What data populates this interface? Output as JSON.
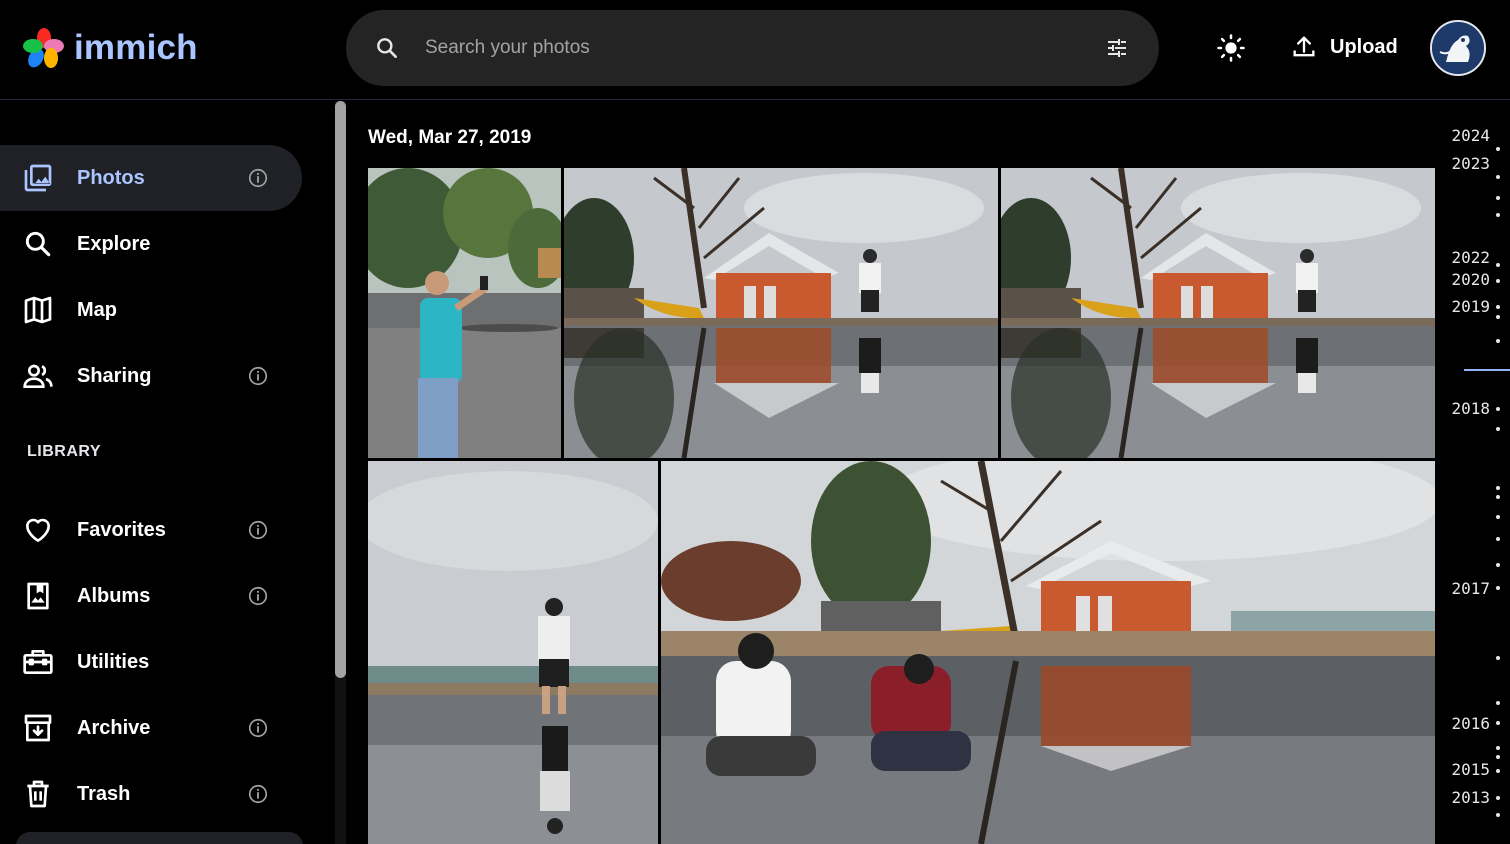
{
  "app": {
    "name": "immich"
  },
  "header": {
    "search_placeholder": "Search your photos",
    "upload_label": "Upload",
    "theme_toggle_icon": "sun-icon",
    "filter_icon": "sliders-icon"
  },
  "sidebar": {
    "items_top": [
      {
        "label": "Photos",
        "icon": "photos-icon",
        "active": true,
        "info": true
      },
      {
        "label": "Explore",
        "icon": "magnify-icon",
        "active": false,
        "info": false
      },
      {
        "label": "Map",
        "icon": "map-icon",
        "active": false,
        "info": false
      },
      {
        "label": "Sharing",
        "icon": "people-icon",
        "active": false,
        "info": true
      }
    ],
    "library_title": "LIBRARY",
    "items_library": [
      {
        "label": "Favorites",
        "icon": "heart-icon",
        "info": true
      },
      {
        "label": "Albums",
        "icon": "album-icon",
        "info": true
      },
      {
        "label": "Utilities",
        "icon": "toolbox-icon",
        "info": false
      },
      {
        "label": "Archive",
        "icon": "archive-icon",
        "info": true
      },
      {
        "label": "Trash",
        "icon": "trash-icon",
        "info": true
      }
    ]
  },
  "main": {
    "date_group_title": "Wed, Mar 27, 2019"
  },
  "timeline": {
    "years": [
      "2024",
      "2023",
      "2022",
      "2020",
      "2019",
      "2018",
      "2017",
      "2016",
      "2015",
      "2013"
    ]
  },
  "colors": {
    "accent": "#aac5ff",
    "background": "#000000",
    "surface": "#242424"
  }
}
